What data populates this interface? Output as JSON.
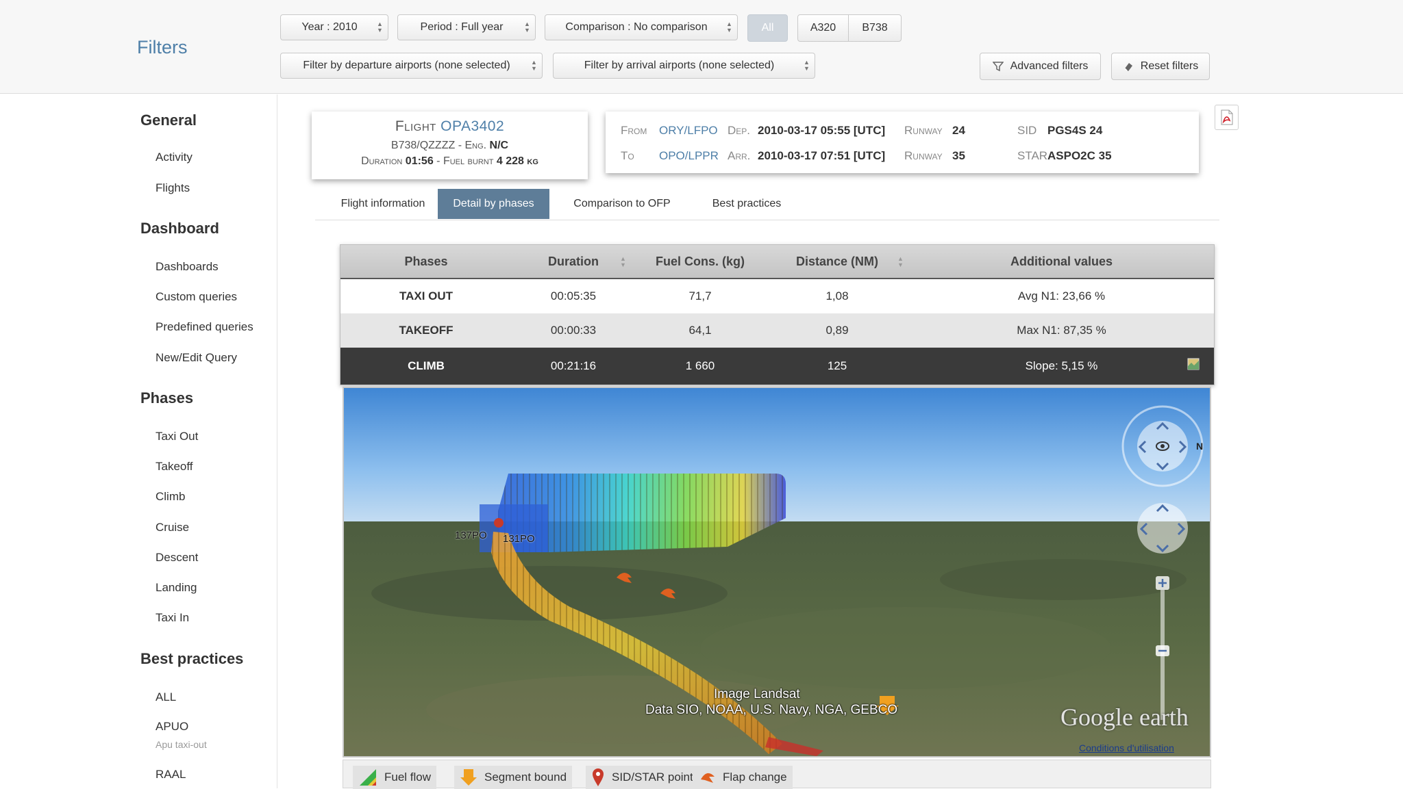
{
  "filters": {
    "title": "Filters",
    "year": "Year : 2010",
    "period": "Period : Full year",
    "comparison": "Comparison : No comparison",
    "aircraft": [
      "All",
      "A320",
      "B738"
    ],
    "departure": "Filter by departure airports (none selected)",
    "arrival": "Filter by arrival airports (none selected)",
    "advanced": "Advanced filters",
    "reset": "Reset filters"
  },
  "sidebar": {
    "general": "General",
    "general_items": [
      "Activity",
      "Flights"
    ],
    "dashboard": "Dashboard",
    "dashboard_items": [
      "Dashboards",
      "Custom queries",
      "Predefined queries",
      "New/Edit Query"
    ],
    "phases": "Phases",
    "phases_items": [
      "Taxi Out",
      "Takeoff",
      "Climb",
      "Cruise",
      "Descent",
      "Landing",
      "Taxi In"
    ],
    "best": "Best practices",
    "best_items": [
      {
        "label": "ALL",
        "sub": ""
      },
      {
        "label": "APUO",
        "sub": "Apu taxi-out"
      },
      {
        "label": "RAAL",
        "sub": ""
      }
    ]
  },
  "flight": {
    "title_label": "Flight",
    "number": "OPA3402",
    "aircraft": "B738/QZZZZ",
    "eng_label": "Eng.",
    "eng": "N/C",
    "duration_label": "Duration",
    "duration": "01:56",
    "fuel_label": "Fuel burnt",
    "fuel": "4 228 kg"
  },
  "route": {
    "from_label": "From",
    "from": "ORY/LFPO",
    "to_label": "To",
    "to": "OPO/LPPR",
    "dep_label": "Dep.",
    "dep": "2010-03-17 05:55 [UTC]",
    "arr_label": "Arr.",
    "arr": "2010-03-17 07:51 [UTC]",
    "runway_label": "Runway",
    "runway_dep": "24",
    "runway_arr": "35",
    "sid_label": "SID",
    "sid": "PGS4S 24",
    "star_label": "STAR",
    "star": "ASPO2C 35"
  },
  "tabs": [
    "Flight information",
    "Detail by phases",
    "Comparison to OFP",
    "Best practices"
  ],
  "table": {
    "headers": [
      "Phases",
      "Duration",
      "Fuel Cons. (kg)",
      "Distance (NM)",
      "Additional values"
    ],
    "rows": [
      [
        "TAXI OUT",
        "00:05:35",
        "71,7",
        "1,08",
        "Avg N1: 23,66 %"
      ],
      [
        "TAKEOFF",
        "00:00:33",
        "64,1",
        "0,89",
        "Max N1: 87,35 %"
      ],
      [
        "CLIMB",
        "00:21:16",
        "1 660",
        "125",
        "Slope: 5,15 %"
      ]
    ]
  },
  "map": {
    "label_a": "137PO",
    "label_b": "131PO",
    "credit_1": "Image Landsat",
    "credit_2": "Data SIO, NOAA, U.S. Navy, NGA, GEBCO",
    "brand": "Google earth",
    "terms": "Conditions d'utilisation"
  },
  "legend": [
    "Fuel flow",
    "Segment bound",
    "SID/STAR point",
    "Flap change"
  ],
  "colors": {
    "accent": "#4e7fa8",
    "active_tab": "#5e7d98",
    "selected_row": "#3a3a3a"
  }
}
